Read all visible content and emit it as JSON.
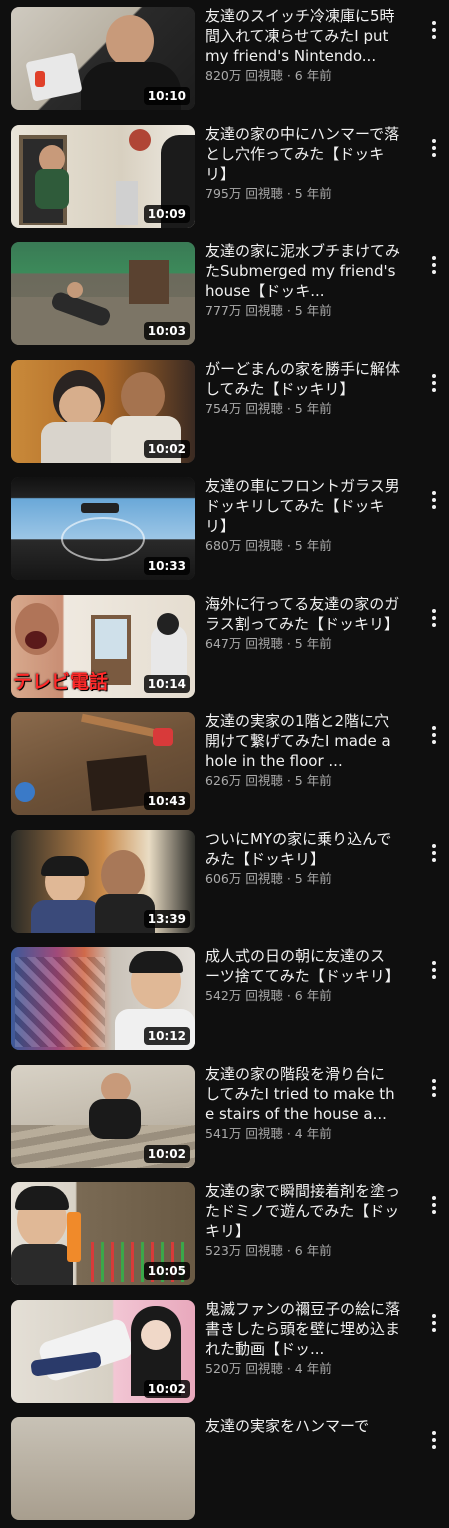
{
  "videos": [
    {
      "title": "友達のスイッチ冷凍庫に5時間入れて凍らせてみたI put my friend's Nintendo...",
      "views": "820万 回視聴",
      "age": "6 年前",
      "duration": "10:10",
      "overlay": ""
    },
    {
      "title": "友達の家の中にハンマーで落とし穴作ってみた【ドッキリ】",
      "views": "795万 回視聴",
      "age": "5 年前",
      "duration": "10:09",
      "overlay": ""
    },
    {
      "title": "友達の家に泥水ブチまけてみたSubmerged my friend's house【ドッキ...",
      "views": "777万 回視聴",
      "age": "5 年前",
      "duration": "10:03",
      "overlay": ""
    },
    {
      "title": "がーどまんの家を勝手に解体してみた【ドッキリ】",
      "views": "754万 回視聴",
      "age": "5 年前",
      "duration": "10:02",
      "overlay": ""
    },
    {
      "title": "友達の車にフロントガラス男ドッキリしてみた【ドッキリ】",
      "views": "680万 回視聴",
      "age": "5 年前",
      "duration": "10:33",
      "overlay": ""
    },
    {
      "title": "海外に行ってる友達の家のガラス割ってみた【ドッキリ】",
      "views": "647万 回視聴",
      "age": "5 年前",
      "duration": "10:14",
      "overlay": "テレビ電話"
    },
    {
      "title": "友達の実家の1階と2階に穴開けて繋げてみたI made a hole in the floor ...",
      "views": "626万 回視聴",
      "age": "5 年前",
      "duration": "10:43",
      "overlay": ""
    },
    {
      "title": "ついにMYの家に乗り込んでみた【ドッキリ】",
      "views": "606万 回視聴",
      "age": "5 年前",
      "duration": "13:39",
      "overlay": ""
    },
    {
      "title": "成人式の日の朝に友達のスーツ捨ててみた【ドッキリ】",
      "views": "542万 回視聴",
      "age": "6 年前",
      "duration": "10:12",
      "overlay": ""
    },
    {
      "title": "友達の家の階段を滑り台にしてみたI tried to make the stairs of the house a...",
      "views": "541万 回視聴",
      "age": "4 年前",
      "duration": "10:02",
      "overlay": ""
    },
    {
      "title": "友達の家で瞬間接着剤を塗ったドミノで遊んでみた【ドッキリ】",
      "views": "523万 回視聴",
      "age": "6 年前",
      "duration": "10:05",
      "overlay": ""
    },
    {
      "title": "鬼滅ファンの禰豆子の絵に落書きしたら頭を壁に埋め込まれた動画【ドッ...",
      "views": "520万 回視聴",
      "age": "4 年前",
      "duration": "10:02",
      "overlay": ""
    },
    {
      "title": "友達の実家をハンマーで",
      "views": "",
      "age": "",
      "duration": "",
      "overlay": ""
    }
  ],
  "separator": " · ",
  "icons": {
    "menu": "more-vert-icon"
  },
  "colors": {
    "background": "#0f0f0f",
    "title": "#f1f1f1",
    "meta": "#aaaaaa"
  }
}
